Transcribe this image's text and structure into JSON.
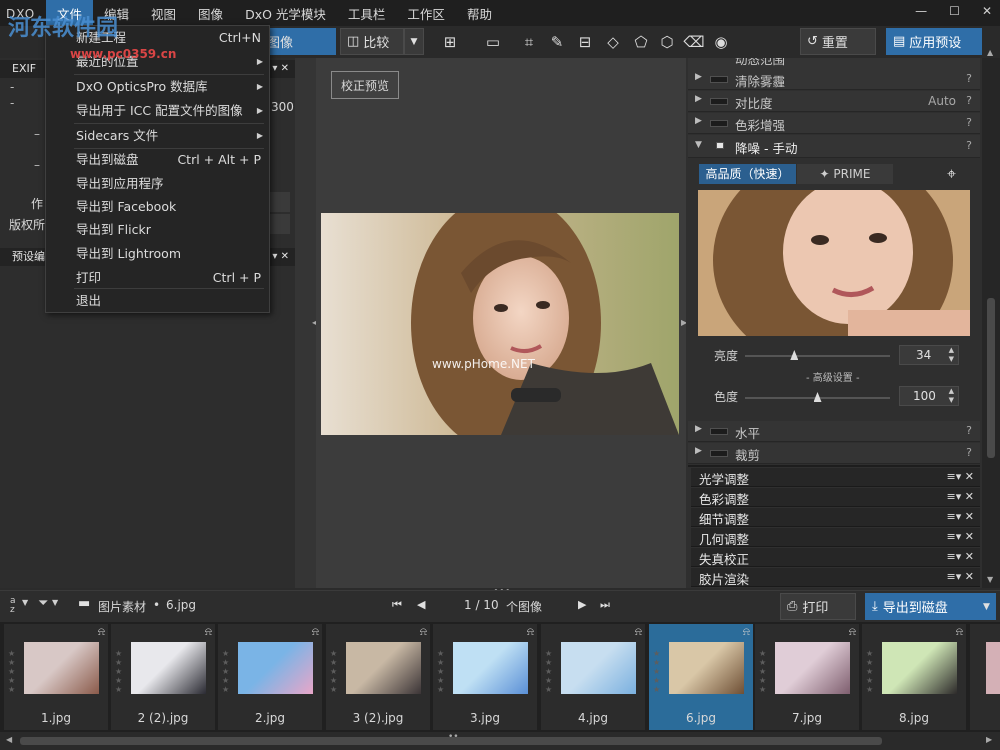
{
  "app": {
    "logo": "DXO",
    "menus": [
      "文件",
      "编辑",
      "视图",
      "图像",
      "DxO 光学模块",
      "工具栏",
      "工作区",
      "帮助"
    ],
    "active_menu": "文件",
    "window_buttons": [
      "—",
      "☐",
      "✕"
    ]
  },
  "watermark": {
    "text": "河东软件园",
    "url": "www.pc0359.cn"
  },
  "toolbar": {
    "image_tab": "图像",
    "compare": "比较",
    "reset": "重置",
    "apply_preset": "应用预设"
  },
  "file_menu": {
    "items": [
      {
        "label": "新建工程",
        "shortcut": "Ctrl+N",
        "submenu": false
      },
      {
        "label": "最近的位置",
        "shortcut": "",
        "submenu": true
      },
      {
        "label": "DxO OpticsPro 数据库",
        "shortcut": "",
        "submenu": true
      },
      {
        "label": "导出用于 ICC 配置文件的图像",
        "shortcut": "",
        "submenu": true
      },
      {
        "label": "Sidecars 文件",
        "shortcut": "",
        "submenu": true
      },
      {
        "label": "导出到磁盘",
        "shortcut": "Ctrl + Alt + P",
        "submenu": false
      },
      {
        "label": "导出到应用程序",
        "shortcut": "",
        "submenu": false
      },
      {
        "label": "导出到 Facebook",
        "shortcut": "",
        "submenu": false
      },
      {
        "label": "导出到 Flickr",
        "shortcut": "",
        "submenu": false
      },
      {
        "label": "导出到 Lightroom",
        "shortcut": "",
        "submenu": false
      },
      {
        "label": "打印",
        "shortcut": "Ctrl + P",
        "submenu": false
      },
      {
        "label": "退出",
        "shortcut": "",
        "submenu": false
      }
    ]
  },
  "left_panel": {
    "exif_header": "EXIF",
    "exif_value": "300",
    "author_label": "作",
    "copyright_label": "版权所",
    "preset_header": "预设编"
  },
  "center": {
    "preview_button": "校正预览",
    "photo_watermark": "www.pHome.NET"
  },
  "right_panel": {
    "top_partial": "动态范围",
    "corrections": [
      {
        "label": "清除雾霾",
        "value": "",
        "expanded": false
      },
      {
        "label": "对比度",
        "value": "Auto",
        "expanded": false
      },
      {
        "label": "色彩增强",
        "value": "",
        "expanded": false
      }
    ],
    "noise": {
      "label": "降噪 - 手动",
      "tab_hq": "高品质（快速）",
      "tab_prime": "✦ PRIME",
      "luminance_label": "亮度",
      "luminance_value": "34",
      "advanced_label": "- 高级设置 -",
      "chroma_label": "色度",
      "chroma_value": "100",
      "luminance_fraction": 0.34,
      "chroma_fraction": 0.5
    },
    "after_noise": [
      {
        "label": "水平"
      },
      {
        "label": "裁剪"
      }
    ],
    "palettes": [
      "光学调整",
      "色彩调整",
      "细节调整",
      "几何调整",
      "失真校正",
      "胶片渲染"
    ],
    "palette_controls": "≡▾ ✕",
    "help": "?"
  },
  "bottom_bar": {
    "sort_label": "a z",
    "folder_path": "图片素材",
    "current_file": "6.jpg",
    "separator": "•",
    "counter": "1 / 10",
    "counter_unit": "个图像",
    "print": "打印",
    "export": "导出到磁盘"
  },
  "filmstrip": {
    "thumbs": [
      {
        "name": "1.jpg",
        "selected": false,
        "c1": "#d8c8c6",
        "c2": "#8a5a4a"
      },
      {
        "name": "2 (2).jpg",
        "selected": false,
        "c1": "#e8e8ec",
        "c2": "#2a2a32"
      },
      {
        "name": "2.jpg",
        "selected": false,
        "c1": "#7ab4e6",
        "c2": "#e9a6c8"
      },
      {
        "name": "3 (2).jpg",
        "selected": false,
        "c1": "#c8b8a4",
        "c2": "#3b3436"
      },
      {
        "name": "3.jpg",
        "selected": false,
        "c1": "#bfe0f4",
        "c2": "#5a8fd6"
      },
      {
        "name": "4.jpg",
        "selected": false,
        "c1": "#c7def0",
        "c2": "#7ab0df"
      },
      {
        "name": "6.jpg",
        "selected": true,
        "c1": "#d9c7a7",
        "c2": "#6e4f35"
      },
      {
        "name": "7.jpg",
        "selected": false,
        "c1": "#e0cdd7",
        "c2": "#7e5e6e"
      },
      {
        "name": "8.jpg",
        "selected": false,
        "c1": "#cfe6b6",
        "c2": "#2d2a2a"
      }
    ]
  }
}
